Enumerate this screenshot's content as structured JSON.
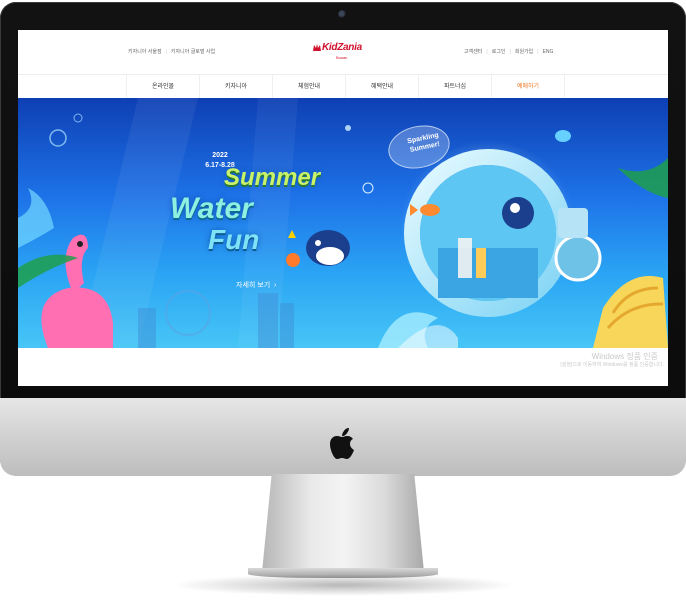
{
  "header": {
    "util_left": [
      "키자니아 서울점",
      "키자니아 글로벌 사업"
    ],
    "logo_main": "KidZania",
    "logo_sub": "Busan",
    "util_right": [
      "고객센터",
      "로그인",
      "회원가입",
      "ENG"
    ]
  },
  "nav": {
    "items": [
      "온라인몰",
      "키자니아",
      "체험안내",
      "혜택안내",
      "파트너십",
      "예매하기"
    ],
    "highlight_color": "#f07a28"
  },
  "banner": {
    "year": "2022",
    "dates": "6.17-8.28",
    "title_line1": "Summer",
    "title_line2": "Water",
    "title_line3": "Fun",
    "detail_link": "자세히 보기",
    "badge": "Sparkling Summer!",
    "colors": {
      "sky_top": "#0e3fb4",
      "sky_bottom": "#47c6f6",
      "summer": "#c9f26a",
      "water": "#8ef0e0"
    }
  },
  "watermark": {
    "line1": "Windows 정품 인증",
    "line2": "[설정]으로 이동하여 Windows를 정품 인증합니다."
  },
  "brand": {
    "primary": "#d0102c"
  }
}
